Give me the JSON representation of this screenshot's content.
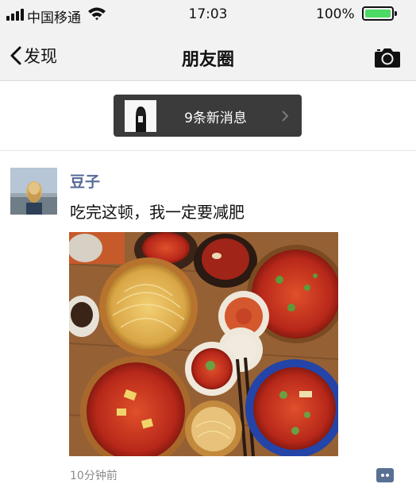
{
  "status_bar": {
    "carrier": "中国移通",
    "time": "17:03",
    "battery_percent": "100%",
    "battery_level": 1.0,
    "battery_color": "#4cd964"
  },
  "nav": {
    "back_label": "发现",
    "title": "朋友圈",
    "right_icon": "camera-icon"
  },
  "new_messages": {
    "label": "9条新消息",
    "icon": "chevron-right-icon"
  },
  "post": {
    "username": "豆子",
    "text": "吃完这顿，我一定要减肥",
    "timestamp": "10分钟前",
    "comment_icon": "comment-icon",
    "username_color": "#576b95"
  }
}
